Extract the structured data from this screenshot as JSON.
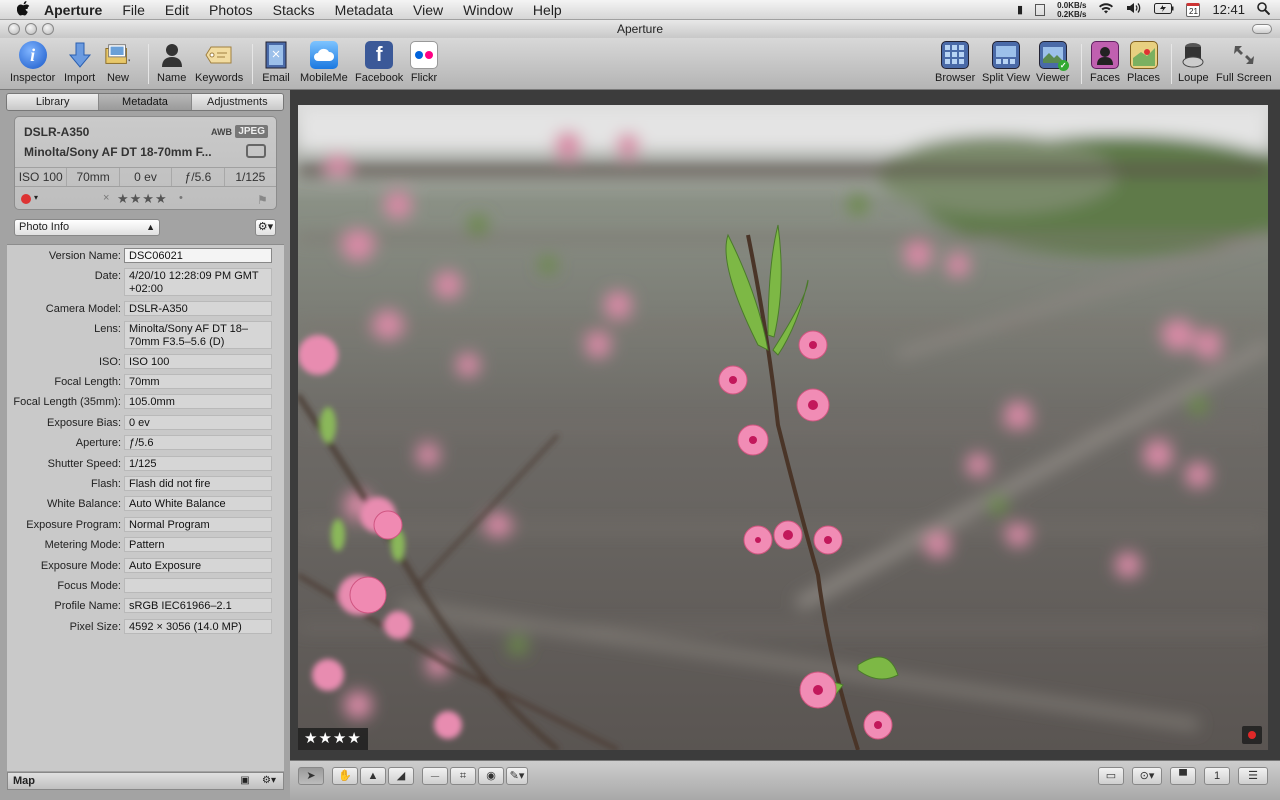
{
  "menubar": {
    "app_name": "Aperture",
    "items": [
      "File",
      "Edit",
      "Photos",
      "Stacks",
      "Metadata",
      "View",
      "Window",
      "Help"
    ],
    "net_up": "0.0KB/s",
    "net_down": "0.2KB/s",
    "calendar_day": "21",
    "clock": "12:41"
  },
  "window": {
    "title": "Aperture"
  },
  "toolbar": {
    "inspector": "Inspector",
    "import": "Import",
    "new": "New",
    "name": "Name",
    "keywords": "Keywords",
    "email": "Email",
    "mobileme": "MobileMe",
    "facebook": "Facebook",
    "flickr": "Flickr",
    "browser": "Browser",
    "split_view": "Split View",
    "viewer": "Viewer",
    "faces": "Faces",
    "places": "Places",
    "loupe": "Loupe",
    "full_screen": "Full Screen"
  },
  "inspector": {
    "tabs": [
      "Library",
      "Metadata",
      "Adjustments"
    ],
    "active_tab": "Metadata",
    "hud": {
      "camera": "DSLR-A350",
      "awb": "AWB",
      "format": "JPEG",
      "lens": "Minolta/Sony AF DT 18-70mm F...",
      "iso": "ISO 100",
      "focal": "70mm",
      "ev": "0 ev",
      "aperture": "ƒ/5.6",
      "shutter": "1/125",
      "rating_stars": "★★★★",
      "reject": "×",
      "dot": "•",
      "label_color": "#d33"
    },
    "view_select": "Photo Info",
    "fields": [
      {
        "label": "Version Name:",
        "value": "DSC06021"
      },
      {
        "label": "Date:",
        "value": "4/20/10 12:28:09 PM GMT +02:00"
      },
      {
        "label": "Camera Model:",
        "value": "DSLR-A350"
      },
      {
        "label": "Lens:",
        "value": "Minolta/Sony AF DT 18–70mm F3.5–5.6 (D)"
      },
      {
        "label": "ISO:",
        "value": "ISO 100"
      },
      {
        "label": "Focal Length:",
        "value": "70mm"
      },
      {
        "label": "Focal Length (35mm):",
        "value": "105.0mm"
      },
      {
        "label": "Exposure Bias:",
        "value": "0 ev"
      },
      {
        "label": "Aperture:",
        "value": "ƒ/5.6"
      },
      {
        "label": "Shutter Speed:",
        "value": "1/125"
      },
      {
        "label": "Flash:",
        "value": "Flash did not fire"
      },
      {
        "label": "White Balance:",
        "value": "Auto White Balance"
      },
      {
        "label": "Exposure Program:",
        "value": "Normal Program"
      },
      {
        "label": "Metering Mode:",
        "value": "Pattern"
      },
      {
        "label": "Exposure Mode:",
        "value": "Auto Exposure"
      },
      {
        "label": "Focus Mode:",
        "value": ""
      },
      {
        "label": "Profile Name:",
        "value": "sRGB IEC61966–2.1"
      },
      {
        "label": "Pixel Size:",
        "value": "4592 × 3056 (14.0 MP)"
      }
    ],
    "map_label": "Map"
  },
  "viewer": {
    "rating_badge": "★★★★",
    "label_color": "#e02828"
  }
}
